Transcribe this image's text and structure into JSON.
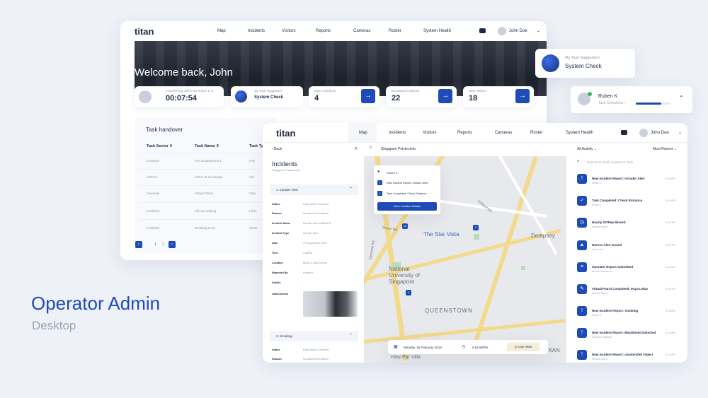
{
  "brand": {
    "logo": "titan"
  },
  "caption": {
    "title": "Operator Admin",
    "subtitle": "Desktop"
  },
  "back": {
    "nav": [
      "Map",
      "Incidents",
      "Visitors",
      "Reports",
      "Cameras",
      "Roster",
      "System Health"
    ],
    "user": "John Doe",
    "welcome": "Welcome back, John",
    "stats": [
      {
        "label": "Transferring shift from Ruben K in",
        "value": "00:07:54"
      },
      {
        "label": "My Task Suggestion",
        "value": "System Check"
      },
      {
        "label": "Open Incidents",
        "value": "4"
      },
      {
        "label": "Escalated Incidents",
        "value": "22"
      },
      {
        "label": "New Visitors",
        "value": "18"
      }
    ],
    "handover": {
      "title": "Task handover",
      "headers": [
        "Task Sector",
        "Task Name",
        "Task Ty"
      ],
      "rows": [
        [
          "Incidents",
          "Fire at Basement 1",
          "Fire"
        ],
        [
          "Visitors",
          "Visitor at Concierge",
          "Visi"
        ],
        [
          "Cameras",
          "Virtual Patrol",
          "Virtu"
        ],
        [
          "Incidents",
          "Lift not working",
          "Lift N"
        ],
        [
          "Incidents",
          "Smoking at B1",
          "Smok"
        ]
      ],
      "pages": [
        "1",
        "2"
      ]
    }
  },
  "suggestion": {
    "label": "My Task Suggestion",
    "value": "System Check"
  },
  "ruben": {
    "name": "Ruben K",
    "sub": "Task Completion"
  },
  "front": {
    "nav": [
      "Map",
      "Incidents",
      "Visitors",
      "Reports",
      "Cameras",
      "Roster",
      "System Health"
    ],
    "user": "John Doe",
    "back": "Back",
    "location": "Singapore Polytechnic",
    "panel": {
      "title": "Incidents",
      "sub": "Singapore Polytechnic",
      "sec1": "1. Intruder Alert",
      "details": [
        [
          "Status",
          "False Alarm Detected"
        ],
        [
          "Reason",
          "No observed incident"
        ],
        [
          "Incident Name",
          "Intruder alert at Block 5"
        ],
        [
          "Incident Type",
          "Intruder Alert"
        ],
        [
          "Date",
          "17 September 2019"
        ],
        [
          "Time",
          "4:48PM"
        ],
        [
          "Location",
          "Block 5, Arts School"
        ],
        [
          "Reported By",
          "Ruben K"
        ],
        [
          "Details",
          "-"
        ],
        [
          "Attachments",
          ""
        ]
      ],
      "sec2": "2. Smoking",
      "details2": [
        [
          "Status",
          "False Alarm Detected"
        ],
        [
          "Reason",
          "No observed incident"
        ]
      ]
    },
    "popup": {
      "name": "Ruben K.",
      "item1": "New Incident Report: Intruder Alert",
      "item2": "Task Completed: Check Entrance",
      "btn": "View Location Details"
    },
    "map": {
      "labels": [
        "The Star Vista",
        "Dempsey",
        "National University of Singapore",
        "QUEENSTOWN",
        "Haw Par Villa",
        "EXAN",
        "Holland Rd",
        "Dover Rd",
        "Clementi Rd"
      ],
      "pins": [
        "12",
        "2",
        "1"
      ]
    },
    "footer": {
      "date": "Monday, 16 February 2019",
      "time": "5:54:56PM",
      "live": "Live View"
    },
    "activity": {
      "filter": "All Activity",
      "sort": "Most Recent",
      "search": "Search for Staff, Incident or Task",
      "items": [
        {
          "title": "New Incident Report: Intruder Alert",
          "sub": "Ruben K",
          "time": "04:29PM",
          "icon": "!"
        },
        {
          "title": "Task Completed: Check Entrance",
          "sub": "Ruben K",
          "time": "04:29PM",
          "icon": "✓"
        },
        {
          "title": "Hourly SITRep Missed",
          "sub": "Richard Myers",
          "time": "03:37PM",
          "icon": "◷"
        },
        {
          "title": "Duress Alert Issued",
          "sub": "Sarah Lee",
          "time": "03:37PM",
          "icon": "▲"
        },
        {
          "title": "Operator Report Submitted",
          "sub": "Steven Grosvenor",
          "time": "02:14PM",
          "icon": "≡"
        },
        {
          "title": "Virtual Patrol Completed: Paya Lebar",
          "sub": "Richard Myers",
          "time": "01:57PM",
          "icon": "✎"
        },
        {
          "title": "New Incident Report: Smoking",
          "sub": "Ruben K",
          "time": "01:46PM",
          "icon": "!"
        },
        {
          "title": "New Incident Report: Blacklisted Detected",
          "sub": "Cameron Williams",
          "time": "01:45PM",
          "icon": "!"
        },
        {
          "title": "New Incident Report: Unattended Object",
          "sub": "Richard Myers",
          "time": "01:42PM",
          "icon": "!"
        }
      ]
    }
  }
}
